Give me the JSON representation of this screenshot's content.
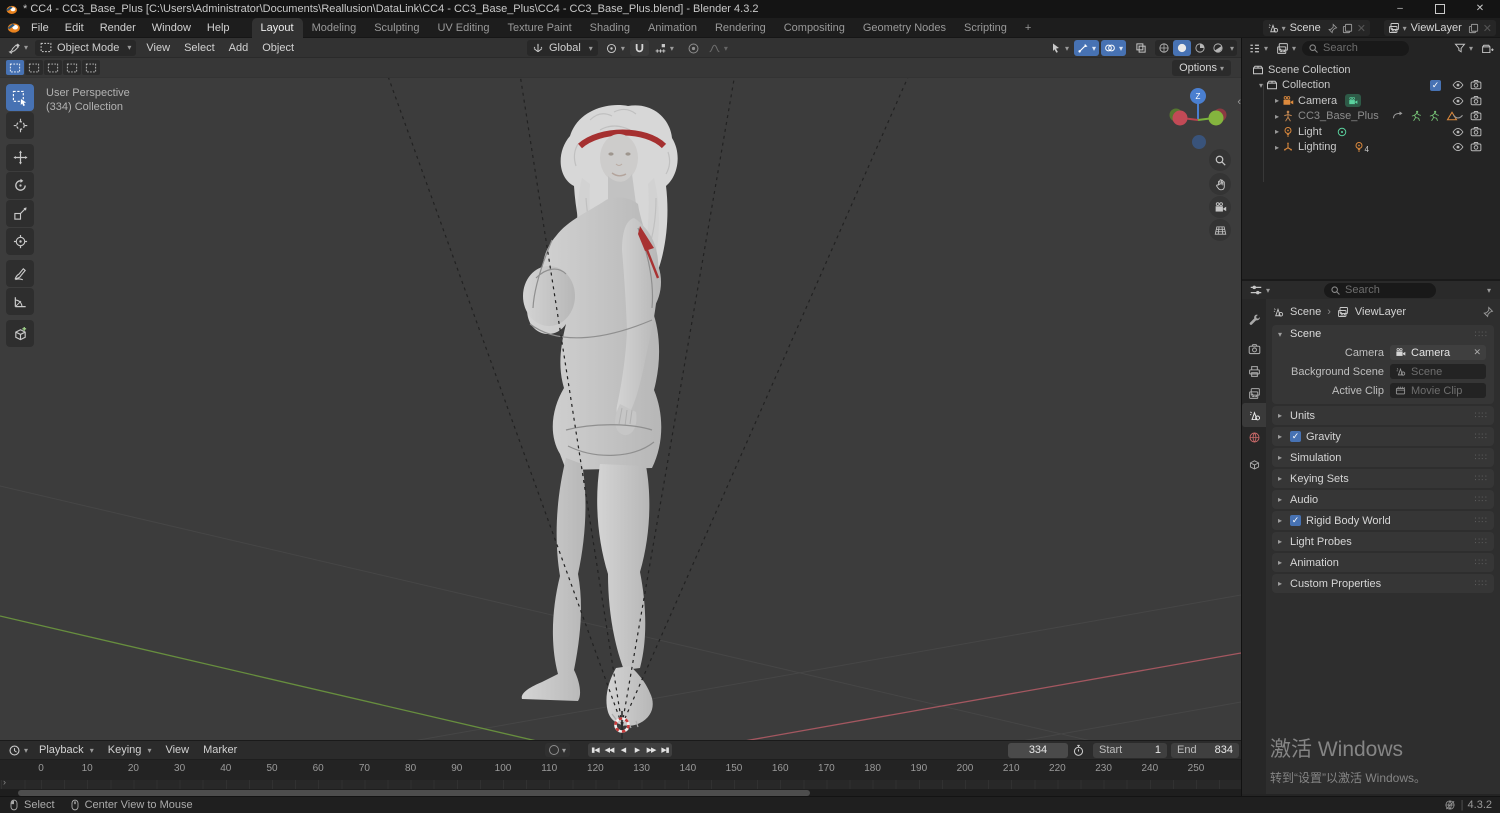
{
  "window": {
    "title": "* CC4 - CC3_Base_Plus [C:\\Users\\Administrator\\Documents\\Reallusion\\DataLink\\CC4 - CC3_Base_Plus\\CC4 - CC3_Base_Plus.blend] - Blender 4.3.2"
  },
  "topbar": {
    "menus": [
      "File",
      "Edit",
      "Render",
      "Window",
      "Help"
    ],
    "workspaces": [
      "Layout",
      "Modeling",
      "Sculpting",
      "UV Editing",
      "Texture Paint",
      "Shading",
      "Animation",
      "Rendering",
      "Compositing",
      "Geometry Nodes",
      "Scripting"
    ],
    "add_workspace": "+",
    "scene": "Scene",
    "view_layer": "ViewLayer"
  },
  "viewport": {
    "mode": "Object Mode",
    "menus": [
      "View",
      "Select",
      "Add",
      "Object"
    ],
    "orientation": "Global",
    "options": "Options",
    "overlay_line1": "User Perspective",
    "overlay_line2": "(334) Collection"
  },
  "outliner": {
    "search_placeholder": "Search",
    "items": [
      {
        "label": "Scene Collection",
        "icon": "collection"
      },
      {
        "label": "Collection",
        "icon": "collection"
      },
      {
        "label": "Camera",
        "icon": "camera"
      },
      {
        "label": "CC3_Base_Plus",
        "icon": "armature"
      },
      {
        "label": "Light",
        "icon": "light"
      },
      {
        "label": "Lighting",
        "icon": "empty"
      }
    ],
    "lighting_badge_count": "4"
  },
  "properties": {
    "search_placeholder": "Search",
    "breadcrumb": {
      "scene": "Scene",
      "view_layer": "ViewLayer"
    },
    "scene_panel": {
      "title": "Scene",
      "camera_label": "Camera",
      "camera_value": "Camera",
      "background_scene_label": "Background Scene",
      "background_scene_placeholder": "Scene",
      "active_clip_label": "Active Clip",
      "active_clip_placeholder": "Movie Clip"
    },
    "panels": [
      {
        "label": "Units",
        "checked": false
      },
      {
        "label": "Gravity",
        "checked": true
      },
      {
        "label": "Simulation",
        "checked": false
      },
      {
        "label": "Keying Sets",
        "checked": false
      },
      {
        "label": "Audio",
        "checked": false
      },
      {
        "label": "Rigid Body World",
        "checked": true
      },
      {
        "label": "Light Probes",
        "checked": false
      },
      {
        "label": "Animation",
        "checked": false
      },
      {
        "label": "Custom Properties",
        "checked": false
      }
    ]
  },
  "timeline": {
    "menus": [
      "Playback",
      "Keying",
      "View",
      "Marker"
    ],
    "current_frame": "334",
    "start_label": "Start",
    "start_value": "1",
    "end_label": "End",
    "end_value": "834",
    "ticks": [
      "0",
      "10",
      "20",
      "30",
      "40",
      "50",
      "60",
      "70",
      "80",
      "90",
      "100",
      "110",
      "120",
      "130",
      "140",
      "150",
      "160",
      "170",
      "180",
      "190",
      "200",
      "210",
      "220",
      "230",
      "240",
      "250"
    ]
  },
  "status": {
    "select_label": "Select",
    "center_label": "Center View to Mouse",
    "version": "4.3.2"
  },
  "watermark": {
    "line1": "激活 Windows",
    "line2": "转到“设置”以激活 Windows。"
  },
  "colors": {
    "accent_blue": "#4772b3",
    "axis_x_red": "#a85560",
    "axis_y_green": "#6f9d3f",
    "outliner_orange": "#dd8a3d",
    "data_green": "#5ad29e",
    "world_red": "#cc6a6a"
  }
}
